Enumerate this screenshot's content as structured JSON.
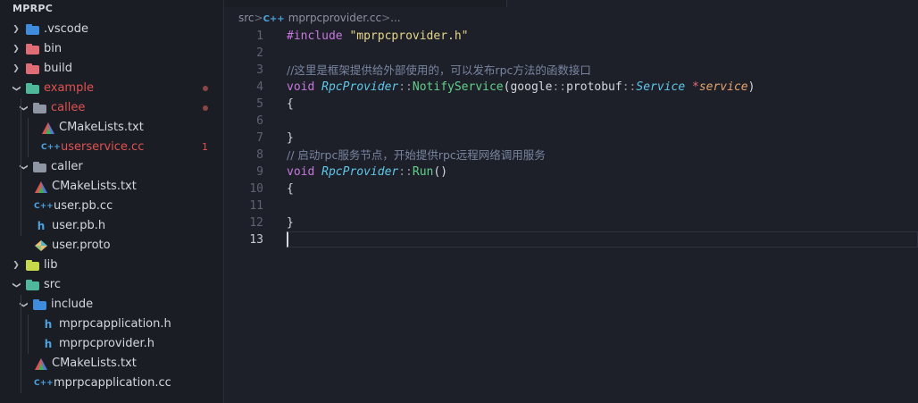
{
  "sidebar": {
    "title": "MPRPC",
    "rows": [
      {
        "label": ".vscode",
        "kind": "folder",
        "icon": "vscode-folder-icon",
        "color": "#3f8cde",
        "chevron": "›",
        "depth": 0
      },
      {
        "label": "bin",
        "kind": "folder",
        "icon": "bin-folder-icon",
        "color": "#e06c75",
        "chevron": "›",
        "depth": 0
      },
      {
        "label": "build",
        "kind": "folder",
        "icon": "build-folder-icon",
        "color": "#e06c75",
        "chevron": "›",
        "depth": 0
      },
      {
        "label": "example",
        "kind": "folder",
        "icon": "example-folder-icon",
        "color": "#4fb89a",
        "chevron": "⌄",
        "depth": 0,
        "error": true,
        "marker": "dot"
      },
      {
        "label": "callee",
        "kind": "folder",
        "icon": "callee-folder-icon",
        "color": "#8f96a3",
        "chevron": "⌄",
        "depth": 1,
        "error": true,
        "marker": "dot"
      },
      {
        "label": "CMakeLists.txt",
        "kind": "file",
        "icon": "cmake-icon",
        "color": "#4b7bd8",
        "depth": 3
      },
      {
        "label": "userservice.cc",
        "kind": "file",
        "icon": "cpp-file-icon",
        "color": "#4da3e0",
        "depth": 3,
        "error": true,
        "count": "1"
      },
      {
        "label": "caller",
        "kind": "folder",
        "icon": "caller-folder-icon",
        "color": "#8f96a3",
        "chevron": "⌄",
        "depth": 1
      },
      {
        "label": "CMakeLists.txt",
        "kind": "file",
        "icon": "cmake-icon",
        "color": "#4b7bd8",
        "depth": 2
      },
      {
        "label": "user.pb.cc",
        "kind": "file",
        "icon": "cpp-file-icon",
        "color": "#4da3e0",
        "depth": 2
      },
      {
        "label": "user.pb.h",
        "kind": "file",
        "icon": "header-file-icon",
        "color": "#4da3e0",
        "depth": 2
      },
      {
        "label": "user.proto",
        "kind": "file",
        "icon": "proto-file-icon",
        "color": "#e5c07b",
        "depth": 2
      },
      {
        "label": "lib",
        "kind": "folder",
        "icon": "lib-folder-icon",
        "color": "#c5d94a",
        "chevron": "›",
        "depth": 0
      },
      {
        "label": "src",
        "kind": "folder",
        "icon": "src-folder-icon",
        "color": "#4fb89a",
        "chevron": "⌄",
        "depth": 0
      },
      {
        "label": "include",
        "kind": "folder",
        "icon": "include-folder-icon",
        "color": "#3f8cde",
        "chevron": "⌄",
        "depth": 1
      },
      {
        "label": "mprpcapplication.h",
        "kind": "file",
        "icon": "header-file-icon",
        "color": "#4da3e0",
        "depth": 3
      },
      {
        "label": "mprpcprovider.h",
        "kind": "file",
        "icon": "header-file-icon",
        "color": "#4da3e0",
        "depth": 3
      },
      {
        "label": "CMakeLists.txt",
        "kind": "file",
        "icon": "cmake-icon",
        "color": "#4b7bd8",
        "depth": 2
      },
      {
        "label": "mprpcapplication.cc",
        "kind": "file",
        "icon": "cpp-file-icon",
        "color": "#4da3e0",
        "depth": 2
      }
    ]
  },
  "breadcrumb": {
    "segments": [
      "src",
      "mprpcprovider.cc",
      "..."
    ],
    "separator": ">",
    "file_icon": "C++"
  },
  "editor": {
    "current_line": 13,
    "lines": [
      {
        "n": "1",
        "tokens": [
          {
            "t": "#include ",
            "c": "pp"
          },
          {
            "t": "\"mprpcprovider.h\"",
            "c": "str"
          }
        ]
      },
      {
        "n": "2",
        "tokens": []
      },
      {
        "n": "3",
        "tokens": [
          {
            "t": "//这里是框架提供给外部使用的，可以发布rpc方法的函数接口",
            "c": "cm"
          }
        ]
      },
      {
        "n": "4",
        "tokens": [
          {
            "t": "void ",
            "c": "kw"
          },
          {
            "t": "RpcProvider",
            "c": "cls"
          },
          {
            "t": "::",
            "c": "op"
          },
          {
            "t": "NotifyService",
            "c": "fn"
          },
          {
            "t": "(google",
            "c": "id"
          },
          {
            "t": "::",
            "c": "op"
          },
          {
            "t": "protobuf",
            "c": "id"
          },
          {
            "t": "::",
            "c": "op"
          },
          {
            "t": "Service ",
            "c": "cls"
          },
          {
            "t": "*",
            "c": "ptr"
          },
          {
            "t": "service",
            "c": "par"
          },
          {
            "t": ")",
            "c": "id"
          }
        ]
      },
      {
        "n": "5",
        "tokens": [
          {
            "t": "{",
            "c": "id"
          }
        ]
      },
      {
        "n": "6",
        "tokens": []
      },
      {
        "n": "7",
        "tokens": [
          {
            "t": "}",
            "c": "id"
          }
        ]
      },
      {
        "n": "8",
        "tokens": [
          {
            "t": "// 启动rpc服务节点，开始提供rpc远程网络调用服务",
            "c": "cm"
          }
        ]
      },
      {
        "n": "9",
        "tokens": [
          {
            "t": "void ",
            "c": "kw"
          },
          {
            "t": "RpcProvider",
            "c": "cls"
          },
          {
            "t": "::",
            "c": "op"
          },
          {
            "t": "Run",
            "c": "fn"
          },
          {
            "t": "()",
            "c": "id"
          }
        ]
      },
      {
        "n": "10",
        "tokens": [
          {
            "t": "{",
            "c": "id"
          }
        ]
      },
      {
        "n": "11",
        "tokens": []
      },
      {
        "n": "12",
        "tokens": [
          {
            "t": "}",
            "c": "id"
          }
        ]
      },
      {
        "n": "13",
        "tokens": []
      }
    ]
  }
}
